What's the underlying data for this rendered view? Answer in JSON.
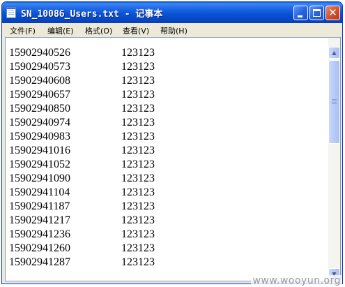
{
  "window": {
    "title": "SN_10086_Users.txt - 记事本"
  },
  "menu": [
    {
      "label": "文件(F)"
    },
    {
      "label": "编辑(E)"
    },
    {
      "label": "格式(O)"
    },
    {
      "label": "查看(V)"
    },
    {
      "label": "帮助(H)"
    }
  ],
  "rows": [
    {
      "user": "15902940526",
      "pass": "123123"
    },
    {
      "user": "15902940573",
      "pass": "123123"
    },
    {
      "user": "15902940608",
      "pass": "123123"
    },
    {
      "user": "15902940657",
      "pass": "123123"
    },
    {
      "user": "15902940850",
      "pass": "123123"
    },
    {
      "user": "15902940974",
      "pass": "123123"
    },
    {
      "user": "15902940983",
      "pass": "123123"
    },
    {
      "user": "15902941016",
      "pass": "123123"
    },
    {
      "user": "15902941052",
      "pass": "123123"
    },
    {
      "user": "15902941090",
      "pass": "123123"
    },
    {
      "user": "15902941104",
      "pass": "123123"
    },
    {
      "user": "15902941187",
      "pass": "123123"
    },
    {
      "user": "15902941217",
      "pass": "123123"
    },
    {
      "user": "15902941236",
      "pass": "123123"
    },
    {
      "user": "15902941260",
      "pass": "123123"
    },
    {
      "user": "15902941287",
      "pass": "123123"
    }
  ],
  "watermark": "www.wooyun.org",
  "colors": {
    "titlebar": "#0a53d6",
    "close_button": "#d8512d",
    "window_face": "#ece9d8"
  },
  "icons": [
    "notepad-icon",
    "minimize-icon",
    "maximize-icon",
    "close-icon",
    "scroll-up-arrow-icon",
    "scroll-down-arrow-icon"
  ]
}
